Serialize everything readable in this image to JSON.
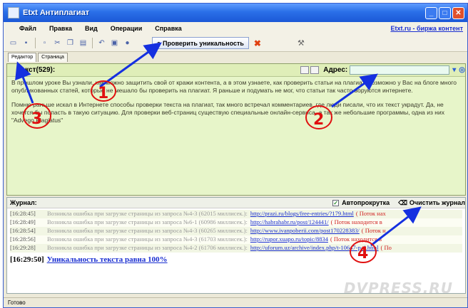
{
  "window": {
    "title": "Etxt Антиплагиат",
    "buttons": [
      "_",
      "□",
      "✕"
    ]
  },
  "menu": {
    "items": [
      "Файл",
      "Правка",
      "Вид",
      "Операции",
      "Справка"
    ],
    "exchange_link": "Etxt.ru - биржа контент"
  },
  "toolbar": {
    "check_label": "Проверить уникальность"
  },
  "tabs": [
    "Редактор",
    "Страница"
  ],
  "editor": {
    "heading": "Текст(529):",
    "address_label": "Адрес:",
    "address_value": "",
    "paragraphs": [
      "В прошлом уроке Вы узнали, как можно защитить свой от кражи контента, а в этом узнаете, как проверить статьи на плагиат. Возможно у Вас на блоге много опубликованных статей, которые не мешало бы проверить на плагиат. Я раньше и подумать не мог, что статьи так часто воруются интернете.",
      "Помню раньше искал в Интернете способы проверки текста на плагиат, так много встречал комментариев, где люди писали, что их текст украдут. Да, не хочется бы попасть в такую ситуацию. Для проверки веб-страниц существую специальные онлайн-сервиса, а так же небольшие программы, одна из них \"Advego Plagiatus\""
    ]
  },
  "journal": {
    "label": "Журнал:",
    "autoscroll_label": "Автопрокрутка",
    "clear_label": "Очистить журнал",
    "rows": [
      {
        "time": "[16:28:45]",
        "msg": "Возникла ошибка при загрузке страницы из запроса №4-3 (62015 миллисек.):",
        "url": "http://prazi.ru/blogs/free-entries/?179.html",
        "flow": "( Поток нах"
      },
      {
        "time": "[16:28:49]",
        "msg": "Возникла ошибка при загрузке страницы из запроса №6-1 (60986 миллисек.):",
        "url": "http://habrahabr.ru/post/124441/",
        "flow": "( Поток находится в"
      },
      {
        "time": "[16:28:54]",
        "msg": "Возникла ошибка при загрузке страницы из запроса №4-3 (60265 миллисек.):",
        "url": "http://www.ivanpoberii.com/post170228383/",
        "flow": "( Поток н"
      },
      {
        "time": "[16:28:56]",
        "msg": "Возникла ошибка при загрузке страницы из запроса №4-3 (61703 миллисек.):",
        "url": "http://rupor.xuapo.ru/topic/8834",
        "flow": "( Поток находится в"
      },
      {
        "time": "[16:29:28]",
        "msg": "Возникла ошибка при загрузке страницы из запроса №4-2 (61706 миллисек.):",
        "url": "http://uforum.uz/archive/index.php/t-10647-p-4.html",
        "flow": "( По"
      }
    ],
    "final_time": "[16:29:50]",
    "final_text": "Уникальность текста равна 100%"
  },
  "watermark": "DVPRESS.RU",
  "status": "Готово",
  "annotations": [
    "1",
    "2",
    "3",
    "4"
  ],
  "colors": {
    "editor_bg": "#e7f5c9",
    "accent": "#1a2fd1",
    "annotation": "#e01010"
  }
}
